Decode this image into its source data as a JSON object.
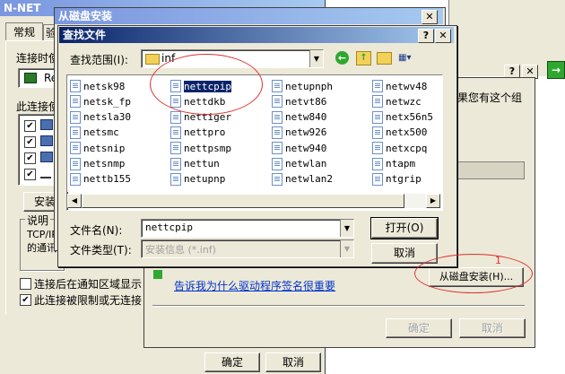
{
  "props_window": {
    "title": "N-NET",
    "tabs": [
      "常规",
      "验"
    ],
    "connect_label": "连接时使",
    "adapter_text": "Re",
    "components_label": "此连接使",
    "install_button": "安装",
    "desc_label": "说明",
    "desc_text": "TCP/IP",
    "desc_text2": "的通讯",
    "notify_option": "连接后在通知区域显示",
    "limited_option": "此连接被限制或无连接",
    "ok_button": "确定",
    "cancel_button": "取消"
  },
  "install_wizard": {
    "right_text": "果您有这个组",
    "link_text": "告诉我为什么驱动程序签名很重要",
    "have_disk_button": "从磁盘安装(H)...",
    "ok_button": "确定",
    "cancel_button": "取消"
  },
  "install_from_disk": {
    "title": "从磁盘安装"
  },
  "find_file": {
    "title": "查找文件",
    "look_in_label": "查找范围(I):",
    "look_in_value": "inf",
    "files": [
      [
        "netsk98",
        "netsk_fp",
        "netsla30",
        "netsmc",
        "netsnip",
        "netsnmp",
        "nettb155"
      ],
      [
        "nettcpip",
        "nettdkb",
        "nettiger",
        "nettpro",
        "nettpsmp",
        "nettun",
        "netupnp"
      ],
      [
        "netupnph",
        "netvt86",
        "netw840",
        "netw926",
        "netw940",
        "netwlan",
        "netwlan2"
      ],
      [
        "netwv48",
        "netwzc",
        "netx56n5",
        "netx500",
        "netxcpq",
        "ntapm",
        "ntgrip"
      ]
    ],
    "selected_file": "nettcpip",
    "filename_label": "文件名(N):",
    "filename_value": "nettcpip",
    "filetype_label": "文件类型(T):",
    "filetype_value": "安装信息 (*.inf)",
    "open_button": "打开(O)",
    "cancel_button": "取消"
  },
  "annotation": {
    "number": "1"
  }
}
